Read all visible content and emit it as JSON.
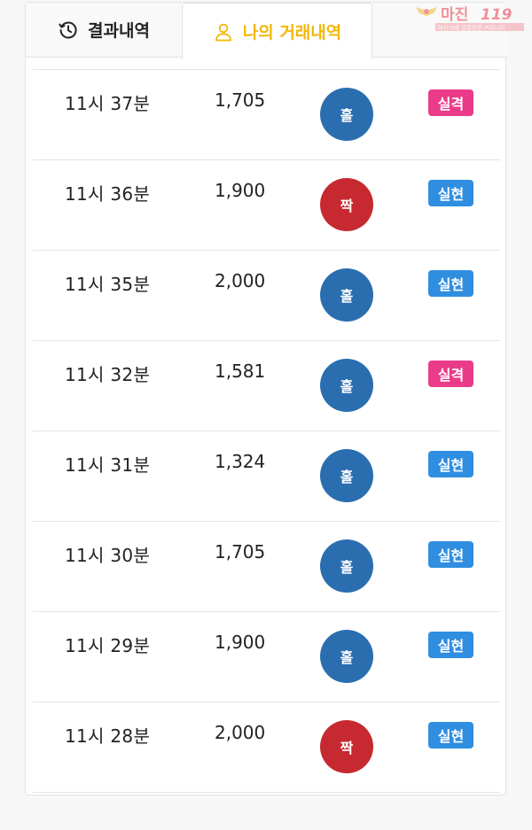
{
  "tabs": {
    "results_label": "결과내역",
    "mine_label": "나의 거래내역"
  },
  "rows": [
    {
      "time": "11시 37분",
      "amount": "1,705",
      "pick": "홀",
      "pick_color": "#2a6eb0",
      "status": "실격",
      "status_color": "#ea3b8a"
    },
    {
      "time": "11시 36분",
      "amount": "1,900",
      "pick": "짝",
      "pick_color": "#c62a30",
      "status": "실현",
      "status_color": "#2f8ee0"
    },
    {
      "time": "11시 35분",
      "amount": "2,000",
      "pick": "홀",
      "pick_color": "#2a6eb0",
      "status": "실현",
      "status_color": "#2f8ee0"
    },
    {
      "time": "11시 32분",
      "amount": "1,581",
      "pick": "홀",
      "pick_color": "#2a6eb0",
      "status": "실격",
      "status_color": "#ea3b8a"
    },
    {
      "time": "11시 31분",
      "amount": "1,324",
      "pick": "홀",
      "pick_color": "#2a6eb0",
      "status": "실현",
      "status_color": "#2f8ee0"
    },
    {
      "time": "11시 30분",
      "amount": "1,705",
      "pick": "홀",
      "pick_color": "#2a6eb0",
      "status": "실현",
      "status_color": "#2f8ee0"
    },
    {
      "time": "11시 29분",
      "amount": "1,900",
      "pick": "홀",
      "pick_color": "#2a6eb0",
      "status": "실현",
      "status_color": "#2f8ee0"
    },
    {
      "time": "11시 28분",
      "amount": "2,000",
      "pick": "짝",
      "pick_color": "#c62a30",
      "status": "실현",
      "status_color": "#2f8ee0"
    }
  ],
  "colors": {
    "active_tab": "#f2b705",
    "odd": "#2a6eb0",
    "even": "#c62a30",
    "fail": "#ea3b8a",
    "success": "#2f8ee0"
  },
  "watermark": {
    "logo_text": "마진",
    "logo_number": "119",
    "sub_text": "마진거래 검증전문 커뮤니티"
  }
}
